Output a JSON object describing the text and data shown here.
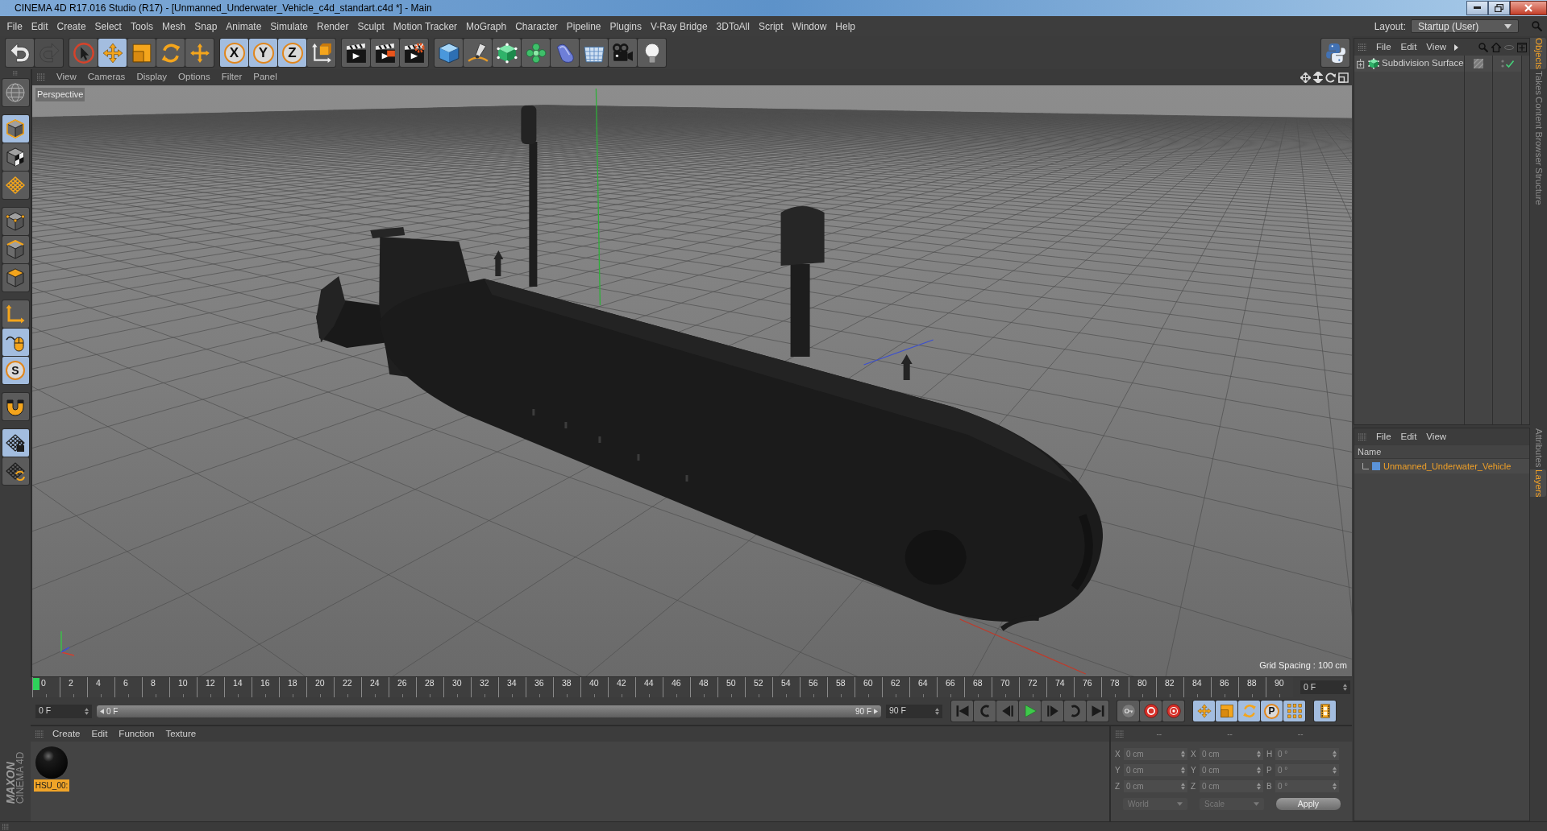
{
  "window": {
    "title": "CINEMA 4D R17.016 Studio (R17) - [Unmanned_Underwater_Vehicle_c4d_standart.c4d *] - Main"
  },
  "menu_bar": {
    "items": [
      "File",
      "Edit",
      "Create",
      "Select",
      "Tools",
      "Mesh",
      "Snap",
      "Animate",
      "Simulate",
      "Render",
      "Sculpt",
      "Motion Tracker",
      "MoGraph",
      "Character",
      "Pipeline",
      "Plugins",
      "V-Ray Bridge",
      "3DToAll",
      "Script",
      "Window",
      "Help"
    ],
    "layout_label": "Layout:",
    "layout_value": "Startup (User)"
  },
  "toolbar": {
    "groups": [
      [
        {
          "kind": "undo",
          "selected": false,
          "disabled": false
        },
        {
          "kind": "redo",
          "selected": false,
          "disabled": true
        }
      ],
      [
        {
          "kind": "select",
          "selected": false,
          "disabled": false
        },
        {
          "kind": "move",
          "selected": true,
          "disabled": false
        },
        {
          "kind": "scale",
          "selected": false,
          "disabled": false
        },
        {
          "kind": "rotate",
          "selected": false,
          "disabled": false
        },
        {
          "kind": "recent",
          "selected": false,
          "disabled": false
        }
      ],
      [
        {
          "kind": "axislock",
          "label": "X",
          "selected": true,
          "disabled": false
        },
        {
          "kind": "axislock",
          "label": "Y",
          "selected": true,
          "disabled": false
        },
        {
          "kind": "axislock",
          "label": "Z",
          "selected": true,
          "disabled": false
        },
        {
          "kind": "coords",
          "selected": false,
          "disabled": false
        }
      ],
      [
        {
          "kind": "render_view",
          "selected": false,
          "disabled": false
        },
        {
          "kind": "render_pv",
          "selected": false,
          "disabled": false
        },
        {
          "kind": "render_settings",
          "selected": false,
          "disabled": false
        }
      ],
      [
        {
          "kind": "cube",
          "selected": false,
          "disabled": false
        },
        {
          "kind": "pen",
          "selected": false,
          "disabled": false
        },
        {
          "kind": "subdiv",
          "selected": false,
          "disabled": false
        },
        {
          "kind": "cloner",
          "selected": false,
          "disabled": false
        },
        {
          "kind": "deformer",
          "selected": false,
          "disabled": false
        },
        {
          "kind": "floor",
          "selected": false,
          "disabled": false
        },
        {
          "kind": "camera",
          "selected": false,
          "disabled": false
        },
        {
          "kind": "light",
          "selected": false,
          "disabled": false
        }
      ]
    ],
    "end_tools": [
      {
        "kind": "python",
        "selected": false,
        "disabled": false
      }
    ]
  },
  "left_toolbar": {
    "groups": [
      [
        {
          "kind": "globe",
          "selected": false
        }
      ],
      [
        {
          "kind": "model",
          "selected": true
        },
        {
          "kind": "texture",
          "selected": false
        },
        {
          "kind": "workplane",
          "selected": false
        }
      ],
      [
        {
          "kind": "points",
          "selected": false
        },
        {
          "kind": "edges",
          "selected": false
        },
        {
          "kind": "polygons",
          "selected": false
        }
      ],
      [
        {
          "kind": "axis",
          "selected": false
        },
        {
          "kind": "tweak",
          "selected": true
        },
        {
          "kind": "solo",
          "label": "S",
          "selected": true
        }
      ],
      [
        {
          "kind": "snap",
          "selected": false
        }
      ],
      [
        {
          "kind": "gridlock",
          "selected": true
        },
        {
          "kind": "gridcycle",
          "selected": false
        }
      ]
    ]
  },
  "viewport": {
    "menu": [
      "View",
      "Cameras",
      "Display",
      "Options",
      "Filter",
      "Panel"
    ],
    "camera": "Perspective",
    "grid_spacing": "Grid Spacing : 100 cm"
  },
  "timeline": {
    "ticks": [
      "0",
      "2",
      "4",
      "6",
      "8",
      "10",
      "12",
      "14",
      "16",
      "18",
      "20",
      "22",
      "24",
      "26",
      "28",
      "30",
      "32",
      "34",
      "36",
      "38",
      "40",
      "42",
      "44",
      "46",
      "48",
      "50",
      "52",
      "54",
      "56",
      "58",
      "60",
      "62",
      "64",
      "66",
      "68",
      "70",
      "72",
      "74",
      "76",
      "78",
      "80",
      "82",
      "84",
      "86",
      "88",
      "90"
    ],
    "playhead": {
      "level": 0
    },
    "frame_field": "0 F"
  },
  "transport": {
    "start_field": "0 F",
    "range": {
      "start": "0 F",
      "end": "90 F",
      "level": 1
    },
    "end_field": "90 F",
    "groups": [
      [
        {
          "kind": "start",
          "selected": false
        },
        {
          "kind": "prevkey",
          "selected": false
        },
        {
          "kind": "prevframe",
          "selected": false
        },
        {
          "kind": "play",
          "selected": false
        },
        {
          "kind": "nextframe",
          "selected": false
        },
        {
          "kind": "nextkey",
          "selected": false
        },
        {
          "kind": "end",
          "selected": false
        }
      ],
      [
        {
          "kind": "key",
          "selected": false
        },
        {
          "kind": "record",
          "selected": false
        },
        {
          "kind": "autokey",
          "selected": false
        }
      ],
      [
        {
          "kind": "tmove",
          "selected": true
        },
        {
          "kind": "tscale",
          "selected": true
        },
        {
          "kind": "trotate",
          "selected": true
        },
        {
          "kind": "param",
          "label": "P",
          "selected": true
        },
        {
          "kind": "dots",
          "selected": true
        }
      ],
      [
        {
          "kind": "film",
          "selected": true
        }
      ]
    ]
  },
  "materials": {
    "menu": [
      "Create",
      "Edit",
      "Function",
      "Texture"
    ],
    "items": [
      {
        "name": "HSU_00:",
        "selected": true
      }
    ]
  },
  "coordinates": {
    "headers": [
      "--",
      "--",
      "--"
    ],
    "rows": [
      {
        "position_axis": "X",
        "position": "0 cm",
        "size_axis": "X",
        "size": "0 cm",
        "rotation_axis": "H",
        "rotation": "0 °"
      },
      {
        "position_axis": "Y",
        "position": "0 cm",
        "size_axis": "Y",
        "size": "0 cm",
        "rotation_axis": "P",
        "rotation": "0 °"
      },
      {
        "position_axis": "Z",
        "position": "0 cm",
        "size_axis": "Z",
        "size": "0 cm",
        "rotation_axis": "B",
        "rotation": "0 °"
      }
    ],
    "coordinate_mode": {
      "value": "World",
      "disabled": true
    },
    "size_mode": {
      "value": "Scale",
      "disabled": true
    },
    "apply": "Apply"
  },
  "objects": {
    "menu": [
      "File",
      "Edit",
      "View"
    ],
    "items": [
      {
        "name": "Subdivision Surface",
        "enabled": true
      }
    ]
  },
  "layers": {
    "menu": [
      "File",
      "Edit",
      "View"
    ],
    "column": "Name",
    "items": [
      {
        "name": "Unmanned_Underwater_Vehicle",
        "color": "#5b93d8"
      }
    ]
  },
  "side_tabs": {
    "upper": [
      {
        "label": "Objects",
        "selected": true
      },
      {
        "label": "Takes",
        "selected": false
      },
      {
        "label": "Content Browser",
        "selected": false
      },
      {
        "label": "Structure",
        "selected": false
      }
    ],
    "lower": [
      {
        "label": "Attributes",
        "selected": false
      },
      {
        "label": "Layers",
        "selected": true
      }
    ]
  },
  "brand": {
    "lines": [
      "MAXON",
      "CINEMA 4D"
    ]
  }
}
